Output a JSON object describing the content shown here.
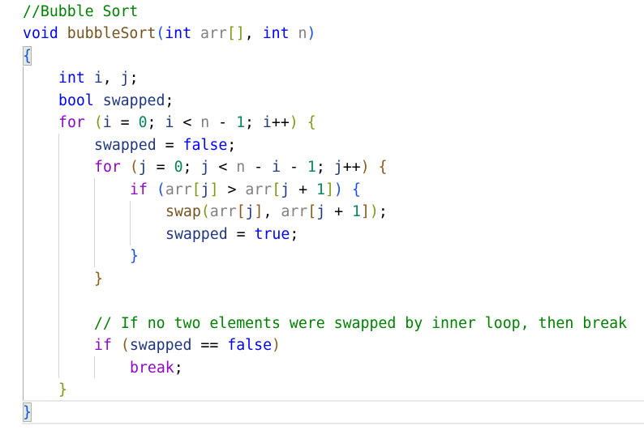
{
  "editor": {
    "language": "cpp",
    "current_line_index": 18,
    "lines": [
      {
        "indent": 0,
        "tokens": [
          {
            "t": "//Bubble Sort",
            "k": "comment"
          }
        ]
      },
      {
        "indent": 0,
        "tokens": [
          {
            "t": "void",
            "k": "keyword"
          },
          {
            "t": " ",
            "k": "op"
          },
          {
            "t": "bubbleSort",
            "k": "func"
          },
          {
            "t": "(",
            "k": "b-blue"
          },
          {
            "t": "int",
            "k": "keyword"
          },
          {
            "t": " ",
            "k": "op"
          },
          {
            "t": "arr",
            "k": "param"
          },
          {
            "t": "[]",
            "k": "b-gold"
          },
          {
            "t": ", ",
            "k": "op"
          },
          {
            "t": "int",
            "k": "keyword"
          },
          {
            "t": " ",
            "k": "op"
          },
          {
            "t": "n",
            "k": "param"
          },
          {
            "t": ")",
            "k": "b-blue"
          }
        ]
      },
      {
        "indent": 0,
        "tokens": [
          {
            "t": "{",
            "k": "b-blue"
          }
        ]
      },
      {
        "indent": 1,
        "tokens": [
          {
            "t": "int",
            "k": "keyword"
          },
          {
            "t": " ",
            "k": "op"
          },
          {
            "t": "i",
            "k": "local"
          },
          {
            "t": ", ",
            "k": "op"
          },
          {
            "t": "j",
            "k": "local"
          },
          {
            "t": ";",
            "k": "op"
          }
        ]
      },
      {
        "indent": 1,
        "tokens": [
          {
            "t": "bool",
            "k": "keyword"
          },
          {
            "t": " ",
            "k": "op"
          },
          {
            "t": "swapped",
            "k": "local"
          },
          {
            "t": ";",
            "k": "op"
          }
        ]
      },
      {
        "indent": 1,
        "tokens": [
          {
            "t": "for",
            "k": "control"
          },
          {
            "t": " ",
            "k": "op"
          },
          {
            "t": "(",
            "k": "b-gold"
          },
          {
            "t": "i",
            "k": "local"
          },
          {
            "t": " = ",
            "k": "op"
          },
          {
            "t": "0",
            "k": "number"
          },
          {
            "t": "; ",
            "k": "op"
          },
          {
            "t": "i",
            "k": "local"
          },
          {
            "t": " < ",
            "k": "op"
          },
          {
            "t": "n",
            "k": "param"
          },
          {
            "t": " - ",
            "k": "op"
          },
          {
            "t": "1",
            "k": "number"
          },
          {
            "t": "; ",
            "k": "op"
          },
          {
            "t": "i",
            "k": "local"
          },
          {
            "t": "++",
            "k": "op"
          },
          {
            "t": ")",
            "k": "b-gold"
          },
          {
            "t": " ",
            "k": "op"
          },
          {
            "t": "{",
            "k": "b-gold"
          }
        ]
      },
      {
        "indent": 2,
        "tokens": [
          {
            "t": "swapped",
            "k": "local"
          },
          {
            "t": " = ",
            "k": "op"
          },
          {
            "t": "false",
            "k": "keyword"
          },
          {
            "t": ";",
            "k": "op"
          }
        ]
      },
      {
        "indent": 2,
        "tokens": [
          {
            "t": "for",
            "k": "control"
          },
          {
            "t": " ",
            "k": "op"
          },
          {
            "t": "(",
            "k": "b-brown"
          },
          {
            "t": "j",
            "k": "local"
          },
          {
            "t": " = ",
            "k": "op"
          },
          {
            "t": "0",
            "k": "number"
          },
          {
            "t": "; ",
            "k": "op"
          },
          {
            "t": "j",
            "k": "local"
          },
          {
            "t": " < ",
            "k": "op"
          },
          {
            "t": "n",
            "k": "param"
          },
          {
            "t": " - ",
            "k": "op"
          },
          {
            "t": "i",
            "k": "local"
          },
          {
            "t": " - ",
            "k": "op"
          },
          {
            "t": "1",
            "k": "number"
          },
          {
            "t": "; ",
            "k": "op"
          },
          {
            "t": "j",
            "k": "local"
          },
          {
            "t": "++",
            "k": "op"
          },
          {
            "t": ")",
            "k": "b-brown"
          },
          {
            "t": " ",
            "k": "op"
          },
          {
            "t": "{",
            "k": "b-brown"
          }
        ]
      },
      {
        "indent": 3,
        "tokens": [
          {
            "t": "if",
            "k": "control"
          },
          {
            "t": " ",
            "k": "op"
          },
          {
            "t": "(",
            "k": "b-blue"
          },
          {
            "t": "arr",
            "k": "param"
          },
          {
            "t": "[",
            "k": "b-gold"
          },
          {
            "t": "j",
            "k": "local"
          },
          {
            "t": "]",
            "k": "b-gold"
          },
          {
            "t": " > ",
            "k": "op"
          },
          {
            "t": "arr",
            "k": "param"
          },
          {
            "t": "[",
            "k": "b-gold"
          },
          {
            "t": "j",
            "k": "local"
          },
          {
            "t": " + ",
            "k": "op"
          },
          {
            "t": "1",
            "k": "number"
          },
          {
            "t": "]",
            "k": "b-gold"
          },
          {
            "t": ")",
            "k": "b-blue"
          },
          {
            "t": " ",
            "k": "op"
          },
          {
            "t": "{",
            "k": "b-blue"
          }
        ]
      },
      {
        "indent": 4,
        "tokens": [
          {
            "t": "swap",
            "k": "func"
          },
          {
            "t": "(",
            "k": "b-gold"
          },
          {
            "t": "arr",
            "k": "param"
          },
          {
            "t": "[",
            "k": "b-brown"
          },
          {
            "t": "j",
            "k": "local"
          },
          {
            "t": "]",
            "k": "b-brown"
          },
          {
            "t": ", ",
            "k": "op"
          },
          {
            "t": "arr",
            "k": "param"
          },
          {
            "t": "[",
            "k": "b-brown"
          },
          {
            "t": "j",
            "k": "local"
          },
          {
            "t": " + ",
            "k": "op"
          },
          {
            "t": "1",
            "k": "number"
          },
          {
            "t": "]",
            "k": "b-brown"
          },
          {
            "t": ")",
            "k": "b-gold"
          },
          {
            "t": ";",
            "k": "op"
          }
        ]
      },
      {
        "indent": 4,
        "tokens": [
          {
            "t": "swapped",
            "k": "local"
          },
          {
            "t": " = ",
            "k": "op"
          },
          {
            "t": "true",
            "k": "keyword"
          },
          {
            "t": ";",
            "k": "op"
          }
        ]
      },
      {
        "indent": 3,
        "tokens": [
          {
            "t": "}",
            "k": "b-blue"
          }
        ]
      },
      {
        "indent": 2,
        "tokens": [
          {
            "t": "}",
            "k": "b-brown"
          }
        ]
      },
      {
        "indent": 0,
        "tokens": []
      },
      {
        "indent": 2,
        "tokens": [
          {
            "t": "// If no two elements were swapped by inner loop, then break",
            "k": "comment"
          }
        ]
      },
      {
        "indent": 2,
        "tokens": [
          {
            "t": "if",
            "k": "control"
          },
          {
            "t": " ",
            "k": "op"
          },
          {
            "t": "(",
            "k": "b-brown"
          },
          {
            "t": "swapped",
            "k": "local"
          },
          {
            "t": " == ",
            "k": "op"
          },
          {
            "t": "false",
            "k": "keyword"
          },
          {
            "t": ")",
            "k": "b-brown"
          }
        ]
      },
      {
        "indent": 3,
        "tokens": [
          {
            "t": "break",
            "k": "control"
          },
          {
            "t": ";",
            "k": "op"
          }
        ]
      },
      {
        "indent": 1,
        "tokens": [
          {
            "t": "}",
            "k": "b-gold"
          }
        ]
      },
      {
        "indent": 0,
        "tokens": [
          {
            "t": "}",
            "k": "b-blue"
          }
        ]
      }
    ]
  }
}
